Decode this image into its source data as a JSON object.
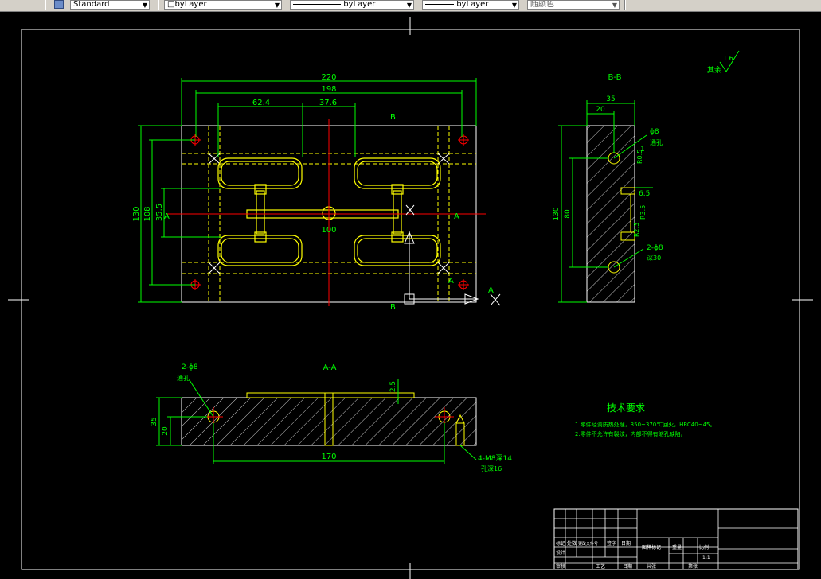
{
  "toolbar": {
    "style_value": "Standard",
    "layer_value": "byLayer",
    "linetype_value": "byLayer",
    "lineweight_value": "byLayer",
    "color_value": "随颜色"
  },
  "drawing": {
    "front_view": {
      "dim_overall_width": "220",
      "dim_inner_width": "198",
      "dim_left_offset": "62.4",
      "dim_right_offset": "37.6",
      "dim_height": "130",
      "dim_inner_height": "108",
      "dim_half_height": "35.5",
      "dim_runner_length": "100",
      "section_b_top": "B",
      "section_b_bottom": "B",
      "section_a_left": "A",
      "section_a_right": "A",
      "section_a_arrow": "A",
      "hole_label": "A"
    },
    "side_view": {
      "title": "B-B",
      "dim_width": "35",
      "dim_depth": "20",
      "dim_height": "130",
      "dim_inner": "80",
      "dim_hole": "ϕ8",
      "dim_hole_sub": "通孔",
      "dim_one": "1",
      "dim_r05": "R0.5",
      "dim_r35": "R3.5",
      "dim_65": "6.5",
      "dim_r23": "R2.3",
      "dim_holes2": "2-ϕ8",
      "dim_holes2_sub": "深30"
    },
    "section_a": {
      "title": "A-A",
      "dim_holes": "2-ϕ8",
      "dim_holes_sub": "通孔",
      "dim_height": "35",
      "dim_inner": "20",
      "dim_groove": "2.5",
      "dim_span": "170",
      "dim_thread": "4-M8深14",
      "dim_thread_sub": "孔深16"
    },
    "roughness": {
      "label": "其余",
      "value": "1.6"
    },
    "tech_requirements": {
      "title": "技术要求",
      "line1": "1.零件经调质热处理，350~370℃回火，HRC40~45。",
      "line2": "2.零件不允许有裂纹，内部不得有缩孔缺陷。"
    },
    "title_block": {
      "cell1": "标记",
      "cell2": "处数",
      "cell3": "更改文件号",
      "cell4": "签字",
      "cell5": "日期",
      "cell6": "设计",
      "cell7": "图样标记",
      "cell8": "重量",
      "cell9": "比例",
      "scale": "1:1",
      "cell10": "审核",
      "cell11": "共张",
      "cell12": "第张",
      "cell13": "工艺",
      "cell14": "日期"
    }
  },
  "colors": {
    "background": "#000000",
    "outline": "#ffffff",
    "dimension": "#00ff00",
    "geometry": "#ffff00",
    "centerline": "#ff0000",
    "text": "#00ff00"
  }
}
